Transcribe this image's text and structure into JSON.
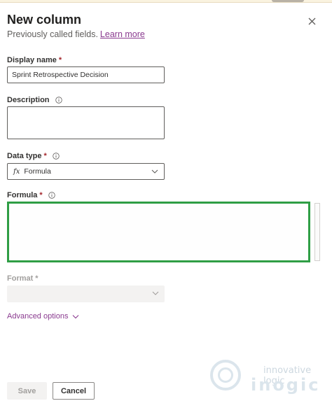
{
  "panel": {
    "title": "New column",
    "subtitle": "Previously called fields.",
    "learn_more": "Learn more"
  },
  "fields": {
    "display_name": {
      "label": "Display name",
      "required_mark": "*",
      "value": "Sprint Retrospective Decision"
    },
    "description": {
      "label": "Description",
      "value": ""
    },
    "data_type": {
      "label": "Data type",
      "required_mark": "*",
      "icon_text": "fx",
      "value": "Formula"
    },
    "formula": {
      "label": "Formula",
      "required_mark": "*",
      "value": ""
    },
    "format": {
      "label": "Format",
      "required_mark": "*",
      "value": ""
    }
  },
  "advanced_options": "Advanced options",
  "buttons": {
    "save": "Save",
    "cancel": "Cancel"
  },
  "watermark": {
    "tagline": "innovative logic",
    "brand": "inogic"
  },
  "colors": {
    "accent_link": "#8a3a8f",
    "formula_highlight": "#2f9e45",
    "required": "#a4262c"
  },
  "icons": {
    "close": "close-icon",
    "info": "info-icon",
    "dropdown": "chevron-down-icon"
  }
}
